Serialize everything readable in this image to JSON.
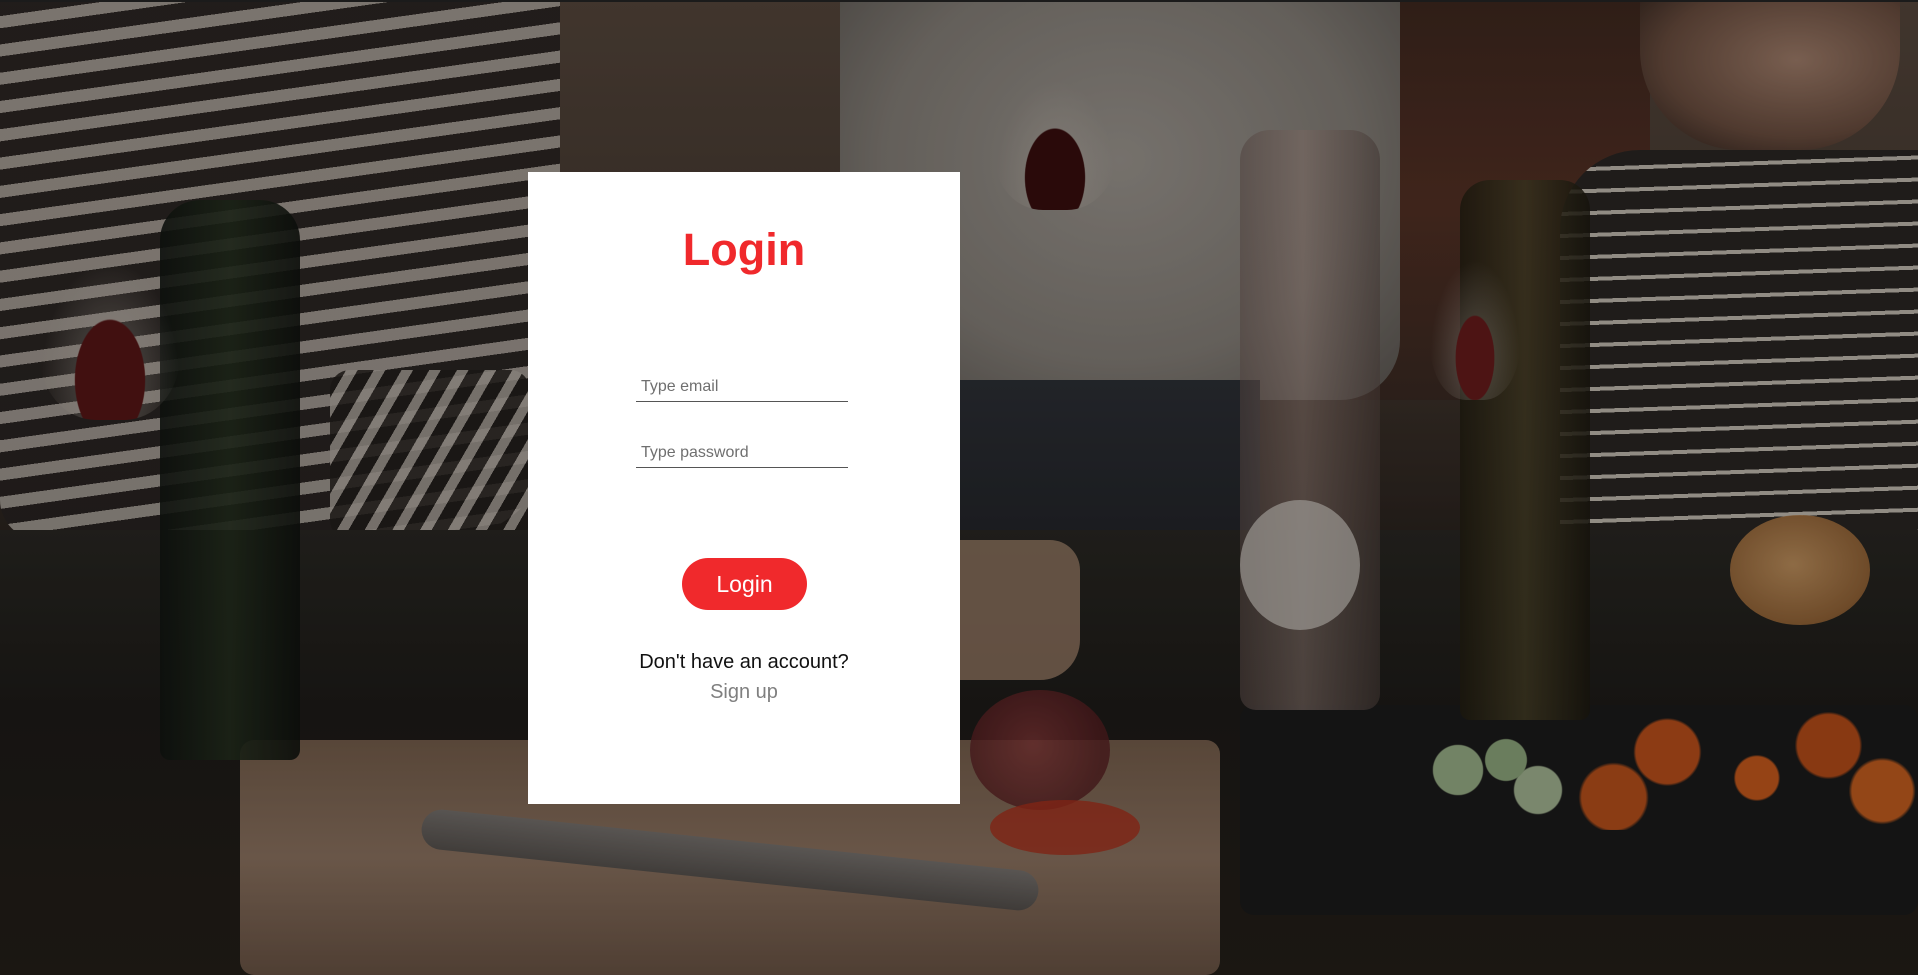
{
  "login": {
    "title": "Login",
    "email_placeholder": "Type email",
    "password_placeholder": "Type password",
    "submit_label": "Login",
    "no_account_text": "Don't have an account?",
    "signup_label": "Sign up"
  },
  "colors": {
    "accent": "#f0292c",
    "card_background": "#ffffff",
    "signup_link": "#7f7f7f"
  }
}
